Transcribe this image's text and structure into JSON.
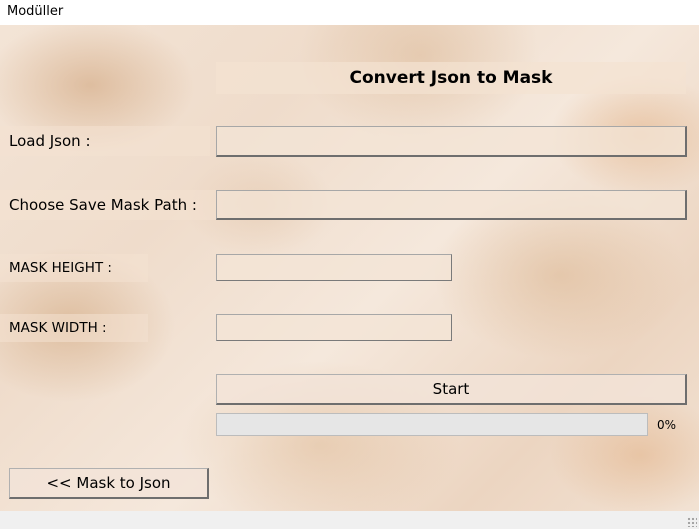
{
  "window": {
    "title": "Modüller"
  },
  "header": {
    "title": "Convert Json to Mask"
  },
  "form": {
    "load_json_label": "Load Json :",
    "load_json_value": "",
    "save_mask_path_label": "Choose Save Mask Path :",
    "save_mask_path_value": "",
    "mask_height_label": "MASK HEIGHT  :",
    "mask_height_value": "",
    "mask_width_label": "MASK WIDTH :",
    "mask_width_value": ""
  },
  "actions": {
    "start_label": "Start",
    "mask_to_json_label": "<< Mask to Json"
  },
  "progress": {
    "value": 0,
    "label": "0%",
    "color": "#06b025"
  },
  "icons": {
    "size_grip": "size-grip-icon"
  },
  "colors": {
    "background_theme": "#efdccb",
    "progress_track": "#e6e6e6"
  }
}
